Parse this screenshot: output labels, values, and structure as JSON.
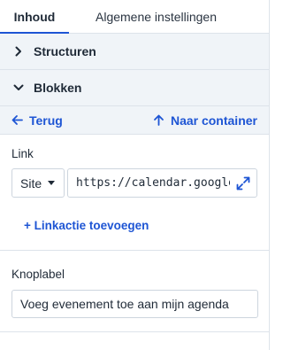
{
  "tabs": [
    {
      "label": "Inhoud",
      "active": true
    },
    {
      "label": "Algemene instellingen",
      "active": false
    }
  ],
  "sections": {
    "structuren": {
      "label": "Structuren",
      "icon": "chevron-right-icon",
      "expanded": false
    },
    "blokken": {
      "label": "Blokken",
      "icon": "chevron-down-icon",
      "expanded": true
    }
  },
  "nav": {
    "back_label": "Terug",
    "back_icon": "arrow-left-icon",
    "container_label": "Naar container",
    "container_icon": "arrow-up-icon"
  },
  "link_field": {
    "label": "Link",
    "type_select": "Site",
    "url_value": "https://calendar.google.co",
    "expand_icon": "expand-icon"
  },
  "add_link_action_label": "+ Linkactie toevoegen",
  "button_label_field": {
    "label": "Knoplabel",
    "value": "Voeg evenement toe aan mijn agenda"
  },
  "colors": {
    "accent": "#1e55d4",
    "panel_bg": "#f0f4f8",
    "border": "#dde3ea",
    "text": "#1f2a37"
  }
}
